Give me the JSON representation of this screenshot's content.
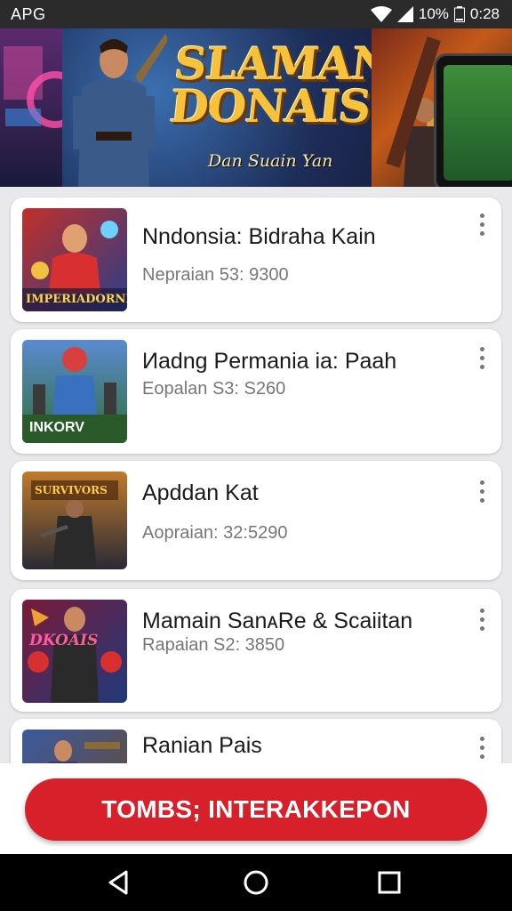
{
  "status_bar": {
    "carrier": "APG",
    "battery": "10%",
    "time": "0:28"
  },
  "banner": {
    "title_line1": "SLAMAN",
    "title_line2": "DONAIS!",
    "subtitle": "Dan Suain Yan"
  },
  "games": [
    {
      "title": "Nndonsia: Bidraha Kain",
      "subtitle": "Nepraian 53: 9300",
      "thumb_text": "IMPERIADORNI",
      "thumb_colors": [
        "#c0302a",
        "#2a3d8a"
      ]
    },
    {
      "title": "Иadng Permania ia: Paah",
      "subtitle": "Eopalan S3: S260",
      "thumb_text": "INKORV",
      "thumb_colors": [
        "#2f6f3a",
        "#8a7a2a"
      ]
    },
    {
      "title": "Apddan Kat",
      "subtitle": "Aopraian: 32:5290",
      "thumb_text": "SURVIVORS",
      "thumb_colors": [
        "#6a3e1a",
        "#2a2a36"
      ]
    },
    {
      "title": "Mamain SanᴀRe & Scaiitan",
      "subtitle": "Rapaian S2: 3850",
      "thumb_text": "DKOAIS",
      "thumb_colors": [
        "#7a1a3a",
        "#1f3a7a"
      ]
    },
    {
      "title": "Ranian Pais",
      "subtitle": "",
      "thumb_text": "",
      "thumb_colors": [
        "#3a5aa0",
        "#6a4a2a"
      ]
    }
  ],
  "cta": {
    "label": "TOMBS; INTERAKKEPON",
    "color": "#d7202a"
  },
  "nav": {
    "back": "back-icon",
    "home": "home-icon",
    "recents": "recents-icon"
  }
}
